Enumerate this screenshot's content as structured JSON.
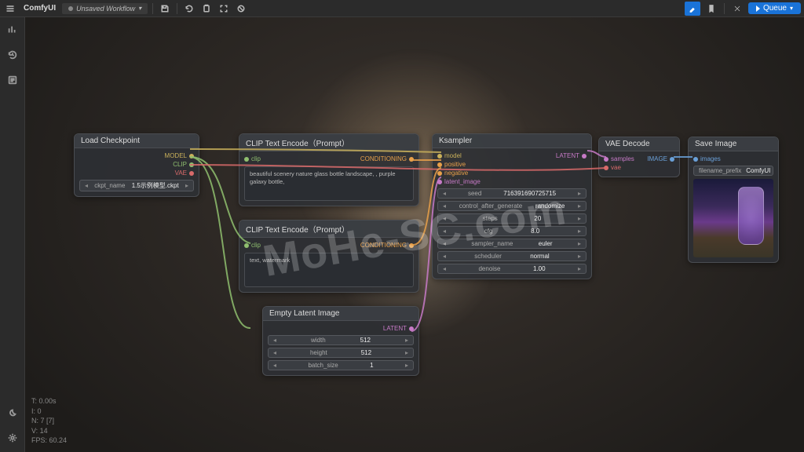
{
  "brand": "ComfyUI",
  "tab": {
    "label": "Unsaved Workflow"
  },
  "queue_label": "Queue",
  "watermark": "MoHe-SC.com",
  "status": {
    "t": "T: 0.00s",
    "i": "I: 0",
    "n": "N: 7 [7]",
    "v": "V: 14",
    "fps": "FPS: 60.24"
  },
  "nodes": {
    "load_ckpt": {
      "title": "Load Checkpoint",
      "outputs": {
        "model": "MODEL",
        "clip": "CLIP",
        "vae": "VAE"
      },
      "widget": {
        "label": "ckpt_name",
        "value": "1.5示例模型.ckpt"
      }
    },
    "clip_pos": {
      "title": "CLIP Text Encode（Prompt）",
      "input": "clip",
      "output": "CONDITIONING",
      "text": "beautiful scenery nature glass bottle landscape, , purple galaxy bottle,"
    },
    "clip_neg": {
      "title": "CLIP Text Encode（Prompt）",
      "input": "clip",
      "output": "CONDITIONING",
      "text": "text, watermark"
    },
    "latent": {
      "title": "Empty Latent Image",
      "output": "LATENT",
      "widgets": [
        {
          "label": "width",
          "value": "512"
        },
        {
          "label": "height",
          "value": "512"
        },
        {
          "label": "batch_size",
          "value": "1"
        }
      ]
    },
    "ksampler": {
      "title": "Ksampler",
      "inputs": {
        "model": "model",
        "positive": "positive",
        "negative": "negative",
        "latent_image": "latent_image"
      },
      "output": "LATENT",
      "widgets": [
        {
          "label": "seed",
          "value": "716391690725715"
        },
        {
          "label": "control_after_generate",
          "value": "randomize"
        },
        {
          "label": "steps",
          "value": "20"
        },
        {
          "label": "cfg",
          "value": "8.0"
        },
        {
          "label": "sampler_name",
          "value": "euler"
        },
        {
          "label": "scheduler",
          "value": "normal"
        },
        {
          "label": "denoise",
          "value": "1.00"
        }
      ]
    },
    "vae_decode": {
      "title": "VAE Decode",
      "inputs": {
        "samples": "samples",
        "vae": "vae"
      },
      "output": "IMAGE"
    },
    "save_image": {
      "title": "Save Image",
      "input": "images",
      "widget": {
        "label": "filename_prefix",
        "value": "ComfyUI"
      }
    }
  }
}
